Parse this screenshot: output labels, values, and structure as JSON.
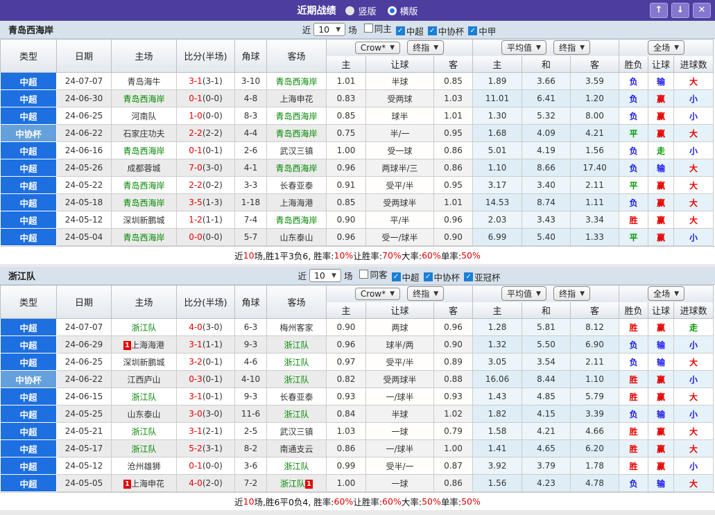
{
  "titlebar": {
    "title": "近期战绩",
    "radios": [
      {
        "label": "竖版",
        "selected": false
      },
      {
        "label": "横版",
        "selected": true
      }
    ],
    "buttons": {
      "up": "↑",
      "down": "↓",
      "close": "✕"
    }
  },
  "columns": {
    "left": [
      "类型",
      "日期",
      "主场",
      "比分(半场)",
      "角球",
      "客场"
    ],
    "odds_sub": [
      "主",
      "让球",
      "客"
    ],
    "avg_sub": [
      "主",
      "和",
      "客"
    ],
    "result_sub": [
      "胜负",
      "让球",
      "进球数"
    ],
    "dropdowns": {
      "odds_src": "Crow*",
      "odds_kind": "终指",
      "avg_src": "平均值",
      "avg_kind": "终指",
      "scope": "全场"
    }
  },
  "colors": {
    "titlebar": "#4c3d9e",
    "league_csl": "#1e6fe0",
    "league_cup": "#64a0dc",
    "focus_team": "#008800",
    "score": "#e60000",
    "win_red": "#e60000",
    "lose_blue": "#1a1aee",
    "draw_green": "#009900"
  },
  "result_color_map": {
    "胜": "r",
    "平": "g",
    "负": "b",
    "赢": "r",
    "输": "b",
    "走": "g",
    "大": "r",
    "小": "b"
  },
  "sections": [
    {
      "team": "青岛西海岸",
      "filters": {
        "prefix": "近",
        "count": "10",
        "suffix": "场",
        "checks": [
          {
            "label": "同主",
            "checked": false
          },
          {
            "label": "中超",
            "checked": true
          },
          {
            "label": "中协杯",
            "checked": true
          },
          {
            "label": "中甲",
            "checked": true
          }
        ]
      },
      "rows": [
        {
          "league": "中超",
          "date": "24-07-07",
          "home": "青岛海牛",
          "home_focus": false,
          "score_ft": "3-1",
          "score_ht": "(3-1)",
          "corner": "3-10",
          "away": "青岛西海岸",
          "away_focus": true,
          "odds": [
            "1.01",
            "半球",
            "0.85"
          ],
          "avg": [
            "1.89",
            "3.66",
            "3.59"
          ],
          "res": [
            "负",
            "输",
            "大"
          ]
        },
        {
          "league": "中超",
          "date": "24-06-30",
          "home": "青岛西海岸",
          "home_focus": true,
          "score_ft": "0-1",
          "score_ht": "(0-0)",
          "corner": "4-8",
          "away": "上海申花",
          "away_focus": false,
          "odds": [
            "0.83",
            "受两球",
            "1.03"
          ],
          "avg": [
            "11.01",
            "6.41",
            "1.20"
          ],
          "res": [
            "负",
            "赢",
            "小"
          ]
        },
        {
          "league": "中超",
          "date": "24-06-25",
          "home": "河南队",
          "home_focus": false,
          "score_ft": "1-0",
          "score_ht": "(0-0)",
          "corner": "8-3",
          "away": "青岛西海岸",
          "away_focus": true,
          "odds": [
            "0.85",
            "球半",
            "1.01"
          ],
          "avg": [
            "1.30",
            "5.32",
            "8.00"
          ],
          "res": [
            "负",
            "赢",
            "小"
          ]
        },
        {
          "league": "中协杯",
          "date": "24-06-22",
          "home": "石家庄功夫",
          "home_focus": false,
          "score_ft": "2-2",
          "score_ht": "(2-2)",
          "corner": "4-4",
          "away": "青岛西海岸",
          "away_focus": true,
          "odds": [
            "0.75",
            "半/一",
            "0.95"
          ],
          "avg": [
            "1.68",
            "4.09",
            "4.21"
          ],
          "res": [
            "平",
            "赢",
            "大"
          ]
        },
        {
          "league": "中超",
          "date": "24-06-16",
          "home": "青岛西海岸",
          "home_focus": true,
          "score_ft": "0-1",
          "score_ht": "(0-1)",
          "corner": "2-6",
          "away": "武汉三镇",
          "away_focus": false,
          "odds": [
            "1.00",
            "受一球",
            "0.86"
          ],
          "avg": [
            "5.01",
            "4.19",
            "1.56"
          ],
          "res": [
            "负",
            "走",
            "小"
          ]
        },
        {
          "league": "中超",
          "date": "24-05-26",
          "home": "成都蓉城",
          "home_focus": false,
          "score_ft": "7-0",
          "score_ht": "(3-0)",
          "corner": "4-1",
          "away": "青岛西海岸",
          "away_focus": true,
          "odds": [
            "0.96",
            "两球半/三",
            "0.86"
          ],
          "avg": [
            "1.10",
            "8.66",
            "17.40"
          ],
          "res": [
            "负",
            "输",
            "大"
          ]
        },
        {
          "league": "中超",
          "date": "24-05-22",
          "home": "青岛西海岸",
          "home_focus": true,
          "score_ft": "2-2",
          "score_ht": "(0-2)",
          "corner": "3-3",
          "away": "长春亚泰",
          "away_focus": false,
          "odds": [
            "0.91",
            "受平/半",
            "0.95"
          ],
          "avg": [
            "3.17",
            "3.40",
            "2.11"
          ],
          "res": [
            "平",
            "赢",
            "大"
          ]
        },
        {
          "league": "中超",
          "date": "24-05-18",
          "home": "青岛西海岸",
          "home_focus": true,
          "score_ft": "3-5",
          "score_ht": "(1-3)",
          "corner": "1-18",
          "away": "上海海港",
          "away_focus": false,
          "odds": [
            "0.85",
            "受两球半",
            "1.01"
          ],
          "avg": [
            "14.53",
            "8.74",
            "1.11"
          ],
          "res": [
            "负",
            "赢",
            "大"
          ]
        },
        {
          "league": "中超",
          "date": "24-05-12",
          "home": "深圳新鹏城",
          "home_focus": false,
          "score_ft": "1-2",
          "score_ht": "(1-1)",
          "corner": "7-4",
          "away": "青岛西海岸",
          "away_focus": true,
          "odds": [
            "0.90",
            "平/半",
            "0.96"
          ],
          "avg": [
            "2.03",
            "3.43",
            "3.34"
          ],
          "res": [
            "胜",
            "赢",
            "大"
          ]
        },
        {
          "league": "中超",
          "date": "24-05-04",
          "home": "青岛西海岸",
          "home_focus": true,
          "score_ft": "0-0",
          "score_ht": "(0-0)",
          "corner": "5-7",
          "away": "山东泰山",
          "away_focus": false,
          "odds": [
            "0.96",
            "受一/球半",
            "0.90"
          ],
          "avg": [
            "6.99",
            "5.40",
            "1.33"
          ],
          "res": [
            "平",
            "赢",
            "小"
          ]
        }
      ],
      "summary": [
        {
          "t": "近"
        },
        {
          "t": "10",
          "red": true
        },
        {
          "t": "场,胜1平3负6, 胜率:"
        },
        {
          "t": "10%",
          "red": true
        },
        {
          "t": " 让胜率:"
        },
        {
          "t": "70%",
          "red": true
        },
        {
          "t": " 大率:"
        },
        {
          "t": "60%",
          "red": true
        },
        {
          "t": " 单率:"
        },
        {
          "t": "50%",
          "red": true
        }
      ]
    },
    {
      "team": "浙江队",
      "filters": {
        "prefix": "近",
        "count": "10",
        "suffix": "场",
        "checks": [
          {
            "label": "同客",
            "checked": false
          },
          {
            "label": "中超",
            "checked": true
          },
          {
            "label": "中协杯",
            "checked": true
          },
          {
            "label": "亚冠杯",
            "checked": true
          }
        ]
      },
      "rows": [
        {
          "league": "中超",
          "date": "24-07-07",
          "home": "浙江队",
          "home_focus": true,
          "score_ft": "4-0",
          "score_ht": "(3-0)",
          "corner": "6-3",
          "away": "梅州客家",
          "away_focus": false,
          "odds": [
            "0.90",
            "两球",
            "0.96"
          ],
          "avg": [
            "1.28",
            "5.81",
            "8.12"
          ],
          "res": [
            "胜",
            "赢",
            "走"
          ]
        },
        {
          "league": "中超",
          "date": "24-06-29",
          "home": "上海海港",
          "home_focus": false,
          "home_badge": "1",
          "score_ft": "3-1",
          "score_ht": "(1-1)",
          "corner": "9-3",
          "away": "浙江队",
          "away_focus": true,
          "odds": [
            "0.96",
            "球半/两",
            "0.90"
          ],
          "avg": [
            "1.32",
            "5.50",
            "6.90"
          ],
          "res": [
            "负",
            "输",
            "小"
          ]
        },
        {
          "league": "中超",
          "date": "24-06-25",
          "home": "深圳新鹏城",
          "home_focus": false,
          "score_ft": "3-2",
          "score_ht": "(0-1)",
          "corner": "4-6",
          "away": "浙江队",
          "away_focus": true,
          "odds": [
            "0.97",
            "受平/半",
            "0.89"
          ],
          "avg": [
            "3.05",
            "3.54",
            "2.11"
          ],
          "res": [
            "负",
            "输",
            "大"
          ]
        },
        {
          "league": "中协杯",
          "date": "24-06-22",
          "home": "江西庐山",
          "home_focus": false,
          "score_ft": "0-3",
          "score_ht": "(0-1)",
          "corner": "4-10",
          "away": "浙江队",
          "away_focus": true,
          "odds": [
            "0.82",
            "受两球半",
            "0.88"
          ],
          "avg": [
            "16.06",
            "8.44",
            "1.10"
          ],
          "res": [
            "胜",
            "赢",
            "小"
          ]
        },
        {
          "league": "中超",
          "date": "24-06-15",
          "home": "浙江队",
          "home_focus": true,
          "score_ft": "3-1",
          "score_ht": "(0-1)",
          "corner": "9-3",
          "away": "长春亚泰",
          "away_focus": false,
          "odds": [
            "0.93",
            "一/球半",
            "0.93"
          ],
          "avg": [
            "1.43",
            "4.85",
            "5.79"
          ],
          "res": [
            "胜",
            "赢",
            "大"
          ]
        },
        {
          "league": "中超",
          "date": "24-05-25",
          "home": "山东泰山",
          "home_focus": false,
          "score_ft": "3-0",
          "score_ht": "(3-0)",
          "corner": "11-6",
          "away": "浙江队",
          "away_focus": true,
          "odds": [
            "0.84",
            "半球",
            "1.02"
          ],
          "avg": [
            "1.82",
            "4.15",
            "3.39"
          ],
          "res": [
            "负",
            "输",
            "小"
          ]
        },
        {
          "league": "中超",
          "date": "24-05-21",
          "home": "浙江队",
          "home_focus": true,
          "score_ft": "3-1",
          "score_ht": "(2-1)",
          "corner": "2-5",
          "away": "武汉三镇",
          "away_focus": false,
          "odds": [
            "1.03",
            "一球",
            "0.79"
          ],
          "avg": [
            "1.58",
            "4.21",
            "4.66"
          ],
          "res": [
            "胜",
            "赢",
            "大"
          ]
        },
        {
          "league": "中超",
          "date": "24-05-17",
          "home": "浙江队",
          "home_focus": true,
          "score_ft": "5-2",
          "score_ht": "(3-1)",
          "corner": "8-2",
          "away": "南通支云",
          "away_focus": false,
          "odds": [
            "0.86",
            "一/球半",
            "1.00"
          ],
          "avg": [
            "1.41",
            "4.65",
            "6.20"
          ],
          "res": [
            "胜",
            "赢",
            "大"
          ]
        },
        {
          "league": "中超",
          "date": "24-05-12",
          "home": "沧州雄狮",
          "home_focus": false,
          "score_ft": "0-1",
          "score_ht": "(0-0)",
          "corner": "3-6",
          "away": "浙江队",
          "away_focus": true,
          "odds": [
            "0.99",
            "受半/一",
            "0.87"
          ],
          "avg": [
            "3.92",
            "3.79",
            "1.78"
          ],
          "res": [
            "胜",
            "赢",
            "小"
          ]
        },
        {
          "league": "中超",
          "date": "24-05-05",
          "home": "上海申花",
          "home_focus": false,
          "home_badge": "1",
          "score_ft": "4-0",
          "score_ht": "(2-0)",
          "corner": "7-2",
          "away": "浙江队",
          "away_focus": true,
          "away_badge": "1",
          "odds": [
            "1.00",
            "一球",
            "0.86"
          ],
          "avg": [
            "1.56",
            "4.23",
            "4.78"
          ],
          "res": [
            "负",
            "输",
            "大"
          ]
        }
      ],
      "summary": [
        {
          "t": "近"
        },
        {
          "t": "10",
          "red": true
        },
        {
          "t": "场,胜6平0负4, 胜率:"
        },
        {
          "t": "60%",
          "red": true
        },
        {
          "t": " 让胜率:"
        },
        {
          "t": "60%",
          "red": true
        },
        {
          "t": " 大率:"
        },
        {
          "t": "50%",
          "red": true
        },
        {
          "t": " 单率:"
        },
        {
          "t": "50%",
          "red": true
        }
      ]
    }
  ]
}
